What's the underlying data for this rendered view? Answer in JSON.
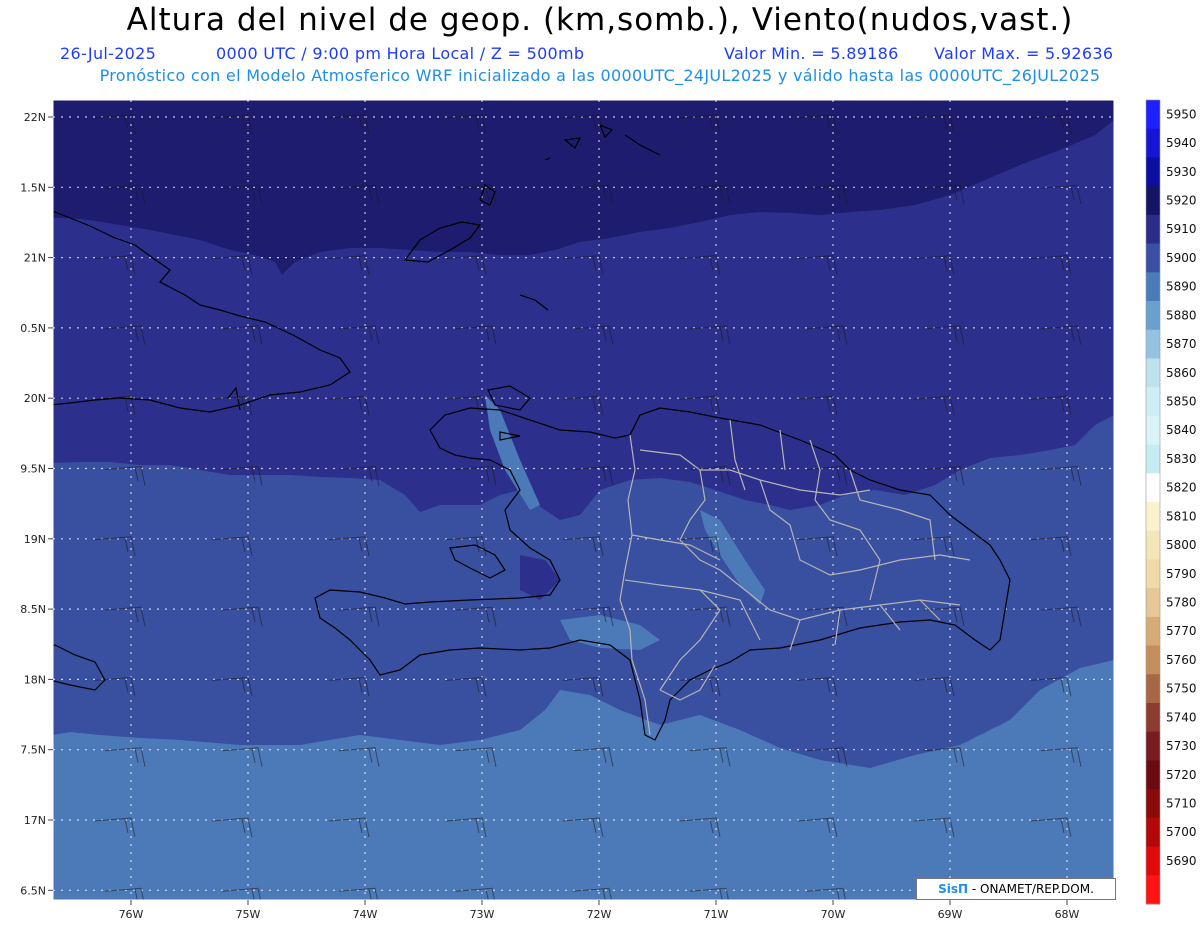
{
  "header": {
    "title": "Altura del nivel de geop. (km,somb.), Viento(nudos,vast.)",
    "date": "26-Jul-2025",
    "time": "0000 UTC / 9:00 pm Hora Local / Z = 500mb",
    "min_value": "Valor Min. = 5.89186",
    "max_value": "Valor Max. = 5.92636",
    "subtitle": "Pronóstico con el Modelo Atmosferico WRF inicializado a las 0000UTC_24JUL2025 y válido hasta las  0000UTC_26JUL2025"
  },
  "map": {
    "lon_labels": [
      "76W",
      "75W",
      "74W",
      "73W",
      "72W",
      "71W",
      "70W",
      "69W",
      "68W"
    ],
    "lat_labels": [
      "22N",
      "1.5N",
      "21N",
      "0.5N",
      "20N",
      "9.5N",
      "19N",
      "8.5N",
      "18N",
      "7.5N",
      "17N",
      "6.5N"
    ],
    "shading_colors": {
      "band_5920": "#1e1c6e",
      "band_5910": "#2c2f8c",
      "band_5900": "#394fa0",
      "band_5890": "#4c7ab8",
      "band_5880": "#6a9ccc"
    },
    "coastline_color": "#000000",
    "province_border_color": "#b4b4b4",
    "grid": "dotted white"
  },
  "colorbar": {
    "levels": [
      5950,
      5940,
      5930,
      5920,
      5910,
      5900,
      5890,
      5880,
      5870,
      5860,
      5850,
      5840,
      5830,
      5820,
      5810,
      5800,
      5790,
      5780,
      5770,
      5760,
      5750,
      5740,
      5730,
      5720,
      5710,
      5700,
      5690
    ],
    "labels": [
      "5950",
      "5940",
      "5930",
      "5920",
      "5910",
      "5900",
      "5890",
      "5880",
      "5870",
      "5860",
      "5850",
      "5840",
      "5830",
      "5820",
      "5810",
      "5800",
      "5790",
      "5780",
      "5770",
      "5760",
      "5750",
      "5740",
      "5730",
      "5720",
      "5710",
      "5700",
      "5690"
    ],
    "colors": [
      "#1e20ff",
      "#1416d4",
      "#0c0ea0",
      "#141462",
      "#2a2c8a",
      "#3a50a2",
      "#4a7cba",
      "#6aa0cc",
      "#94c2e0",
      "#bde2ee",
      "#cdeef4",
      "#d9f3f7",
      "#c5ecf3",
      "#ffffff",
      "#fbf3cd",
      "#f5e6b8",
      "#efdaa8",
      "#e6c896",
      "#d6ac76",
      "#c28e5c",
      "#a76746",
      "#8c3c2e",
      "#781c22",
      "#6c0a14",
      "#8a0a0a",
      "#b40808",
      "#e00a0a",
      "#ff1414"
    ]
  },
  "credit": {
    "logo": "SisΠ",
    "text": " - ONAMET/REP.DOM."
  }
}
